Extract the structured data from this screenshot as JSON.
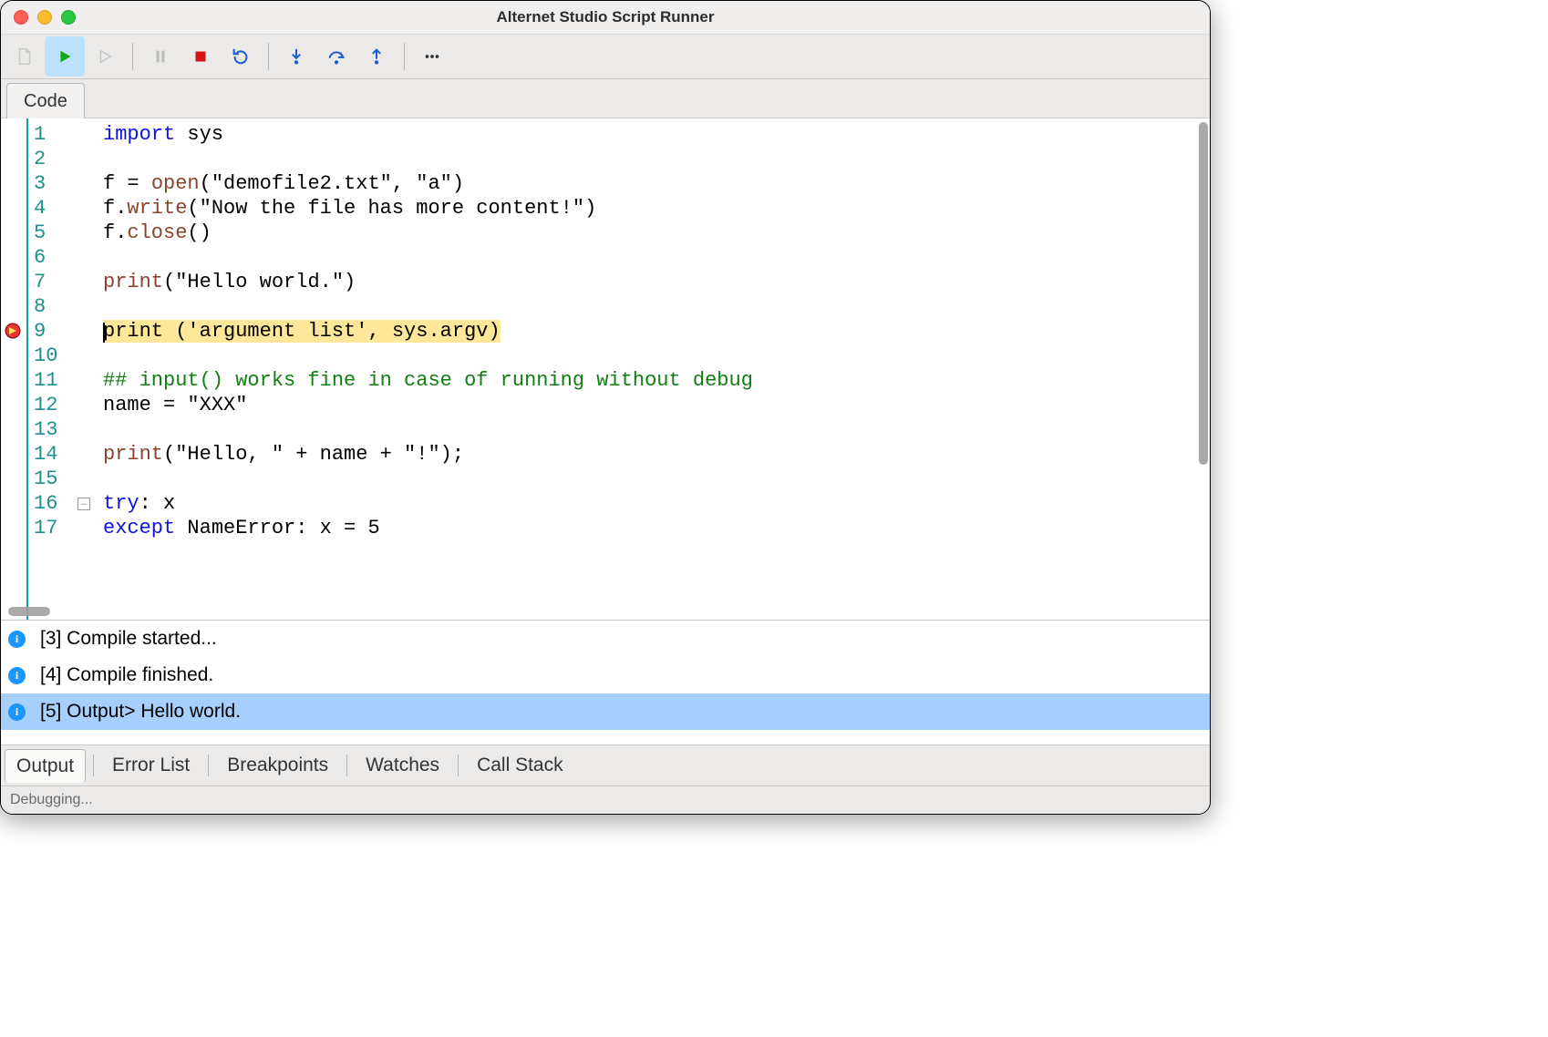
{
  "window": {
    "title": "Alternet Studio Script Runner"
  },
  "toolbar": {
    "new_file_icon": "new-file",
    "run_icon": "run",
    "run_outline_icon": "run-outline",
    "pause_icon": "pause",
    "stop_icon": "stop",
    "restart_icon": "restart",
    "step_into_icon": "step-into",
    "step_over_icon": "step-over",
    "step_out_icon": "step-out",
    "more_icon": "more"
  },
  "editor_tab": {
    "label": "Code"
  },
  "code": {
    "current_line": 9,
    "breakpoint_line": 9,
    "fold_marker_line": 16,
    "lines": [
      {
        "n": 1,
        "tokens": [
          {
            "cls": "kw",
            "t": "import"
          },
          {
            "cls": "txt",
            "t": " sys"
          }
        ]
      },
      {
        "n": 2,
        "tokens": []
      },
      {
        "n": 3,
        "tokens": [
          {
            "cls": "txt",
            "t": "f = "
          },
          {
            "cls": "fn",
            "t": "open"
          },
          {
            "cls": "txt",
            "t": "(\"demofile2.txt\", \"a\")"
          }
        ]
      },
      {
        "n": 4,
        "tokens": [
          {
            "cls": "txt",
            "t": "f."
          },
          {
            "cls": "fn",
            "t": "write"
          },
          {
            "cls": "txt",
            "t": "(\"Now the file has more content!\")"
          }
        ]
      },
      {
        "n": 5,
        "tokens": [
          {
            "cls": "txt",
            "t": "f."
          },
          {
            "cls": "fn",
            "t": "close"
          },
          {
            "cls": "txt",
            "t": "()"
          }
        ]
      },
      {
        "n": 6,
        "tokens": []
      },
      {
        "n": 7,
        "tokens": [
          {
            "cls": "fn",
            "t": "print"
          },
          {
            "cls": "txt",
            "t": "(\"Hello world.\")"
          }
        ]
      },
      {
        "n": 8,
        "tokens": []
      },
      {
        "n": 9,
        "highlight": true,
        "cursor": true,
        "tokens": [
          {
            "cls": "txt",
            "t": "print ('argument list', sys.argv)"
          }
        ]
      },
      {
        "n": 10,
        "tokens": []
      },
      {
        "n": 11,
        "tokens": [
          {
            "cls": "cmt",
            "t": "## input() works fine in case of running without debug"
          }
        ]
      },
      {
        "n": 12,
        "tokens": [
          {
            "cls": "txt",
            "t": "name = \"XXX\""
          }
        ]
      },
      {
        "n": 13,
        "tokens": []
      },
      {
        "n": 14,
        "tokens": [
          {
            "cls": "fn",
            "t": "print"
          },
          {
            "cls": "txt",
            "t": "(\"Hello, \" + name + \"!\");"
          }
        ]
      },
      {
        "n": 15,
        "tokens": []
      },
      {
        "n": 16,
        "tokens": [
          {
            "cls": "kw",
            "t": "try"
          },
          {
            "cls": "txt",
            "t": ": x"
          }
        ]
      },
      {
        "n": 17,
        "tokens": [
          {
            "cls": "kw",
            "t": "except"
          },
          {
            "cls": "txt",
            "t": " NameError: x = 5"
          }
        ]
      }
    ]
  },
  "output": {
    "rows": [
      {
        "selected": false,
        "text": "[3] Compile started..."
      },
      {
        "selected": false,
        "text": "[4] Compile finished."
      },
      {
        "selected": true,
        "text": "[5] Output> Hello world."
      }
    ]
  },
  "bottom_tabs": {
    "items": [
      {
        "label": "Output",
        "active": true
      },
      {
        "label": "Error List",
        "active": false
      },
      {
        "label": "Breakpoints",
        "active": false
      },
      {
        "label": "Watches",
        "active": false
      },
      {
        "label": "Call Stack",
        "active": false
      }
    ]
  },
  "status": {
    "text": "Debugging..."
  }
}
